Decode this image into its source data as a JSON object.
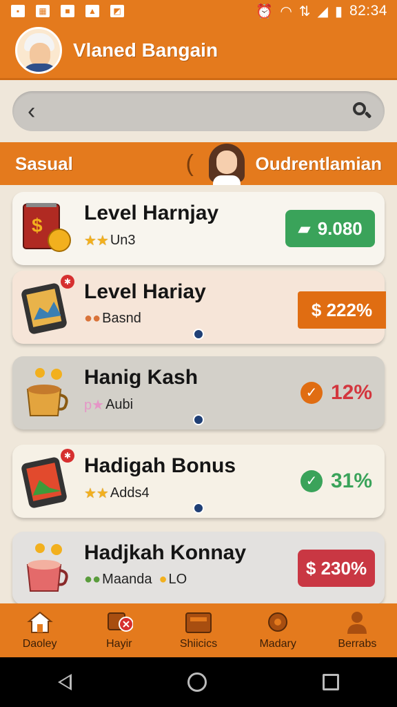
{
  "status_bar": {
    "time": "82:34",
    "left_icons": [
      "notification-icon",
      "qr-icon",
      "message-icon",
      "drive-icon",
      "gallery-icon"
    ],
    "right_icons": [
      "alarm-icon",
      "wifi-icon",
      "data-icon",
      "signal-icon",
      "battery-icon"
    ]
  },
  "header": {
    "title": "Vlaned Bangain"
  },
  "search": {
    "back_icon": "‹",
    "placeholder": ""
  },
  "section_tabs": {
    "left": "Sasual",
    "middle_symbol": "(",
    "right": "Oudrentlamian"
  },
  "cards": [
    {
      "title": "Level Harnjay",
      "subtitle": "Un3",
      "badge_prefix": "★★",
      "value": "9.080",
      "value_style": "green-pill",
      "background": "#f8f5ee"
    },
    {
      "title": "Level Hariay",
      "subtitle": "Basnd",
      "badge_prefix": "●●",
      "value": "$ 222%",
      "value_style": "orange-pill",
      "background": "#f6e5d8"
    },
    {
      "title": "Hanig Kash",
      "subtitle": "Aubi",
      "badge_prefix": "p★",
      "value": "12%",
      "value_style": "orange-check",
      "background": "#d3d0c9"
    },
    {
      "title": "Hadigah Bonus",
      "subtitle": "Adds4",
      "badge_prefix": "★★",
      "value": "31%",
      "value_style": "green-check",
      "background": "#f6f1e6"
    },
    {
      "title": "Hadjkah Konnay",
      "subtitle": "Maanda",
      "subtitle_extra": "LO",
      "badge_prefix": "●●",
      "value": "$ 230%",
      "value_style": "red-pill",
      "background": "#e3e1df"
    }
  ],
  "bottom_nav": [
    {
      "label": "Daoley",
      "icon": "home-icon"
    },
    {
      "label": "Hayir",
      "icon": "cart-cancel-icon"
    },
    {
      "label": "Shiicics",
      "icon": "wallet-icon"
    },
    {
      "label": "Madary",
      "icon": "gear-icon"
    },
    {
      "label": "Berrabs",
      "icon": "user-icon"
    }
  ],
  "colors": {
    "accent": "#e47a1d",
    "green": "#3aa35a",
    "orange": "#e06d12",
    "red": "#c93743"
  }
}
